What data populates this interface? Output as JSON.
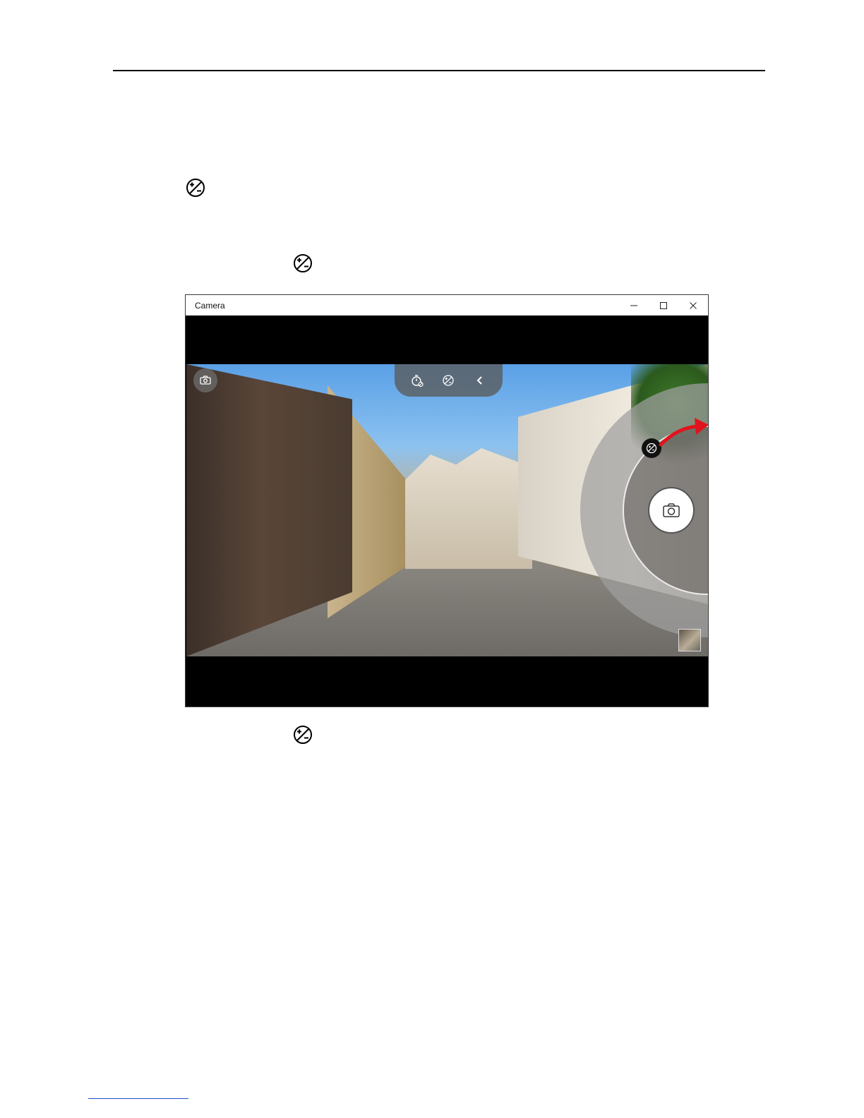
{
  "window": {
    "title": "Camera",
    "controls": [
      "minimize-icon",
      "maximize-icon",
      "close-icon"
    ]
  },
  "toolbar": {
    "icons": [
      "timer-off-icon",
      "exposure-icon",
      "chevron-left-icon"
    ]
  },
  "doc": {
    "icons": [
      "exposure-icon",
      "exposure-icon",
      "exposure-icon"
    ]
  },
  "colors": {
    "arrow": "#e0141e",
    "rule": "#000000",
    "footer_link": "#1f4fd0"
  }
}
